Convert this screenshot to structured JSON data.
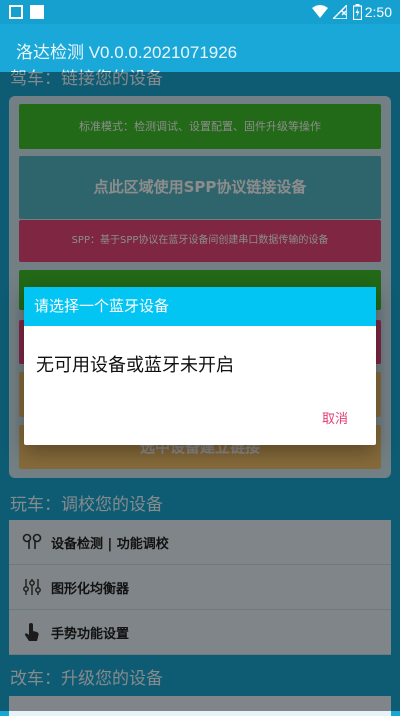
{
  "statusbar": {
    "time": "2:50"
  },
  "app": {
    "title": "洛达检测 V0.0.0.2021071926"
  },
  "section_drive": {
    "title": "驾车：链接您的设备"
  },
  "connect": {
    "standard_mode": "标准模式：检测调试、设置配置、固件升级等操作",
    "spp_area": "点此区域使用SPP协议链接设备",
    "spp_desc": "SPP：基于SPP协议在蓝牙设备间创建串口数据传输的设备",
    "select_device": "选中设备建立链接"
  },
  "section_play": {
    "title": "玩车：调校您的设备"
  },
  "play_items": [
    {
      "label": "设备检测 | 功能调校",
      "icon": "earbuds-icon"
    },
    {
      "label": "图形化均衡器",
      "icon": "equalizer-icon"
    },
    {
      "label": "手势功能设置",
      "icon": "tap-gesture-icon"
    }
  ],
  "section_mod": {
    "title": "改车：升级您的设备"
  },
  "dialog": {
    "title": "请选择一个蓝牙设备",
    "message": "无可用设备或蓝牙未开启",
    "cancel": "取消"
  },
  "colors": {
    "accent": "#03c5f3",
    "green_bar": "#3fbf2c",
    "teal_bar": "#55b7c4",
    "pink_bar": "#e8467a",
    "orange_bar": "#f5c26b"
  }
}
